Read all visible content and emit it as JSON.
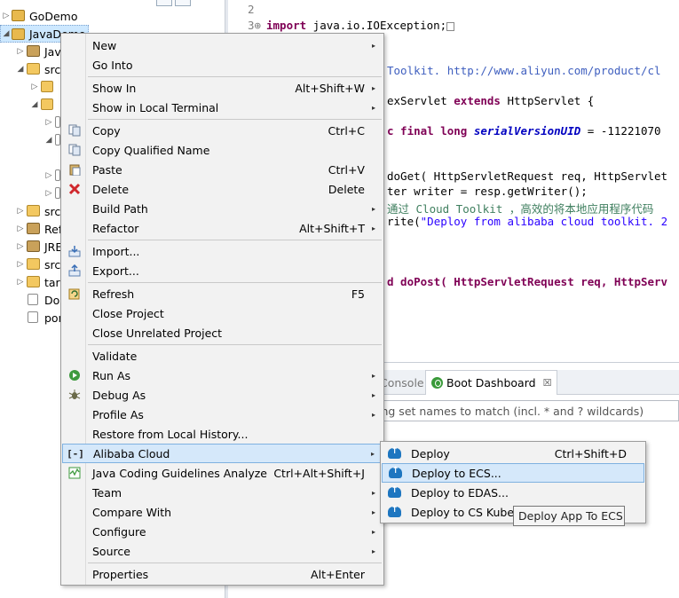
{
  "explorer": {
    "rows": [
      {
        "twisty": "▷",
        "label": "GoDemo"
      },
      {
        "twisty": "◢",
        "label": "JavaDemo"
      },
      {
        "twisty": "▷",
        "label": "Jav"
      },
      {
        "twisty": "◢",
        "label": "src"
      },
      {
        "twisty": "▷",
        "label": "src"
      },
      {
        "twisty": "▷",
        "label": "Ref"
      },
      {
        "twisty": "▷",
        "label": "JRE"
      },
      {
        "twisty": "▷",
        "label": "src"
      },
      {
        "twisty": "▷",
        "label": "targ"
      },
      {
        "twisty": "",
        "label": "Do"
      },
      {
        "twisty": "",
        "label": "pon"
      }
    ]
  },
  "editor": {
    "line_numbers": [
      "2",
      "3⊕"
    ],
    "lines": {
      "import_kw": "import",
      "import_rest": " java.io.IOException;",
      "toolkit_comment": "Toolkit. http://www.aliyun.com/product/cl",
      "class_rest": "exServlet ",
      "extends_kw": "extends",
      "class_tail": " HttpServlet {",
      "field_mod": "c final long ",
      "field_name": "serialVersionUID",
      "field_tail": " = -11221070",
      "doget_line": "doGet( HttpServletRequest req, HttpServlet",
      "writer_line": "ter writer = resp.getWriter();",
      "comment_cn_1": "通过 Cloud Toolkit ，高效的将本地应用程序代码",
      "write_pre": "rite(",
      "write_str": "\"Deploy from alibaba cloud toolkit. 2",
      "dopost_line": "d doPost( HttpServletRequest req, HttpServ"
    }
  },
  "bottom_panel": {
    "tabs": {
      "console": "Console",
      "boot": "Boot Dashboard"
    },
    "close_glyph": "☒",
    "filter_placeholder": "ing set names to match (incl. * and ? wildcards)"
  },
  "context_menu": {
    "items": [
      {
        "label": "New",
        "shortcut": "",
        "submenu": true
      },
      {
        "label": "Go Into",
        "shortcut": "",
        "submenu": false
      },
      {
        "label": "Show In",
        "shortcut": "Alt+Shift+W",
        "submenu": true
      },
      {
        "label": "Show in Local Terminal",
        "shortcut": "",
        "submenu": true
      },
      {
        "label": "Copy",
        "shortcut": "Ctrl+C",
        "submenu": false
      },
      {
        "label": "Copy Qualified Name",
        "shortcut": "",
        "submenu": false
      },
      {
        "label": "Paste",
        "shortcut": "Ctrl+V",
        "submenu": false
      },
      {
        "label": "Delete",
        "shortcut": "Delete",
        "submenu": false
      },
      {
        "label": "Build Path",
        "shortcut": "",
        "submenu": true
      },
      {
        "label": "Refactor",
        "shortcut": "Alt+Shift+T",
        "submenu": true
      },
      {
        "label": "Import...",
        "shortcut": "",
        "submenu": false
      },
      {
        "label": "Export...",
        "shortcut": "",
        "submenu": false
      },
      {
        "label": "Refresh",
        "shortcut": "F5",
        "submenu": false
      },
      {
        "label": "Close Project",
        "shortcut": "",
        "submenu": false
      },
      {
        "label": "Close Unrelated Project",
        "shortcut": "",
        "submenu": false
      },
      {
        "label": "Validate",
        "shortcut": "",
        "submenu": false
      },
      {
        "label": "Run As",
        "shortcut": "",
        "submenu": true
      },
      {
        "label": "Debug As",
        "shortcut": "",
        "submenu": true
      },
      {
        "label": "Profile As",
        "shortcut": "",
        "submenu": true
      },
      {
        "label": "Restore from Local History...",
        "shortcut": "",
        "submenu": false
      },
      {
        "label": "Alibaba Cloud",
        "shortcut": "",
        "submenu": true,
        "highlighted": true
      },
      {
        "label": "Java Coding Guidelines Analyze",
        "shortcut": "Ctrl+Alt+Shift+J",
        "submenu": false
      },
      {
        "label": "Team",
        "shortcut": "",
        "submenu": true
      },
      {
        "label": "Compare With",
        "shortcut": "",
        "submenu": true
      },
      {
        "label": "Configure",
        "shortcut": "",
        "submenu": true
      },
      {
        "label": "Source",
        "shortcut": "",
        "submenu": true
      },
      {
        "label": "Properties",
        "shortcut": "Alt+Enter",
        "submenu": false
      }
    ],
    "arrow_glyph": "▸"
  },
  "submenu": {
    "items": [
      {
        "label": "Deploy",
        "shortcut": "Ctrl+Shift+D"
      },
      {
        "label": "Deploy to ECS...",
        "shortcut": ""
      },
      {
        "label": "Deploy to EDAS...",
        "shortcut": ""
      },
      {
        "label": "Deploy to CS Kuber",
        "shortcut": ""
      }
    ]
  },
  "tooltip": {
    "text": "Deploy App To ECS"
  },
  "colors": {
    "highlight_bg": "#d5e8fa",
    "highlight_border": "#7fb1e0",
    "alibaba_blue": "#1e76c0",
    "keyword": "#7f0055",
    "string": "#2a00ff"
  },
  "icons": {
    "copy": "copy-icon",
    "paste": "paste-icon",
    "delete": "delete-icon",
    "import": "import-icon",
    "export": "export-icon",
    "refresh": "refresh-icon",
    "run": "run-icon",
    "debug": "debug-icon",
    "alibaba": "alibaba-cloud-icon",
    "guidelines": "guidelines-icon",
    "deploy": "cloud-upload-icon"
  }
}
